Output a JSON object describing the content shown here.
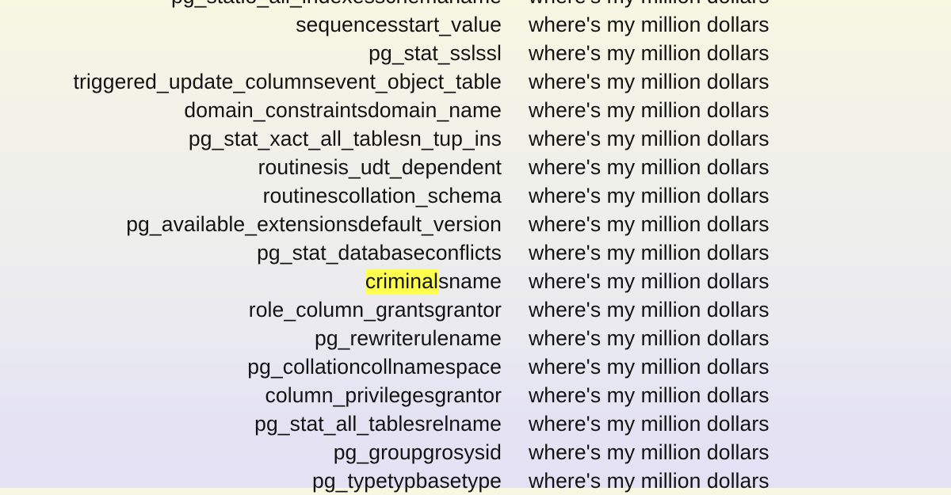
{
  "colors": {
    "background_top": "#f7f7e2",
    "background_mid": "#eeeeec",
    "background_bottom": "#e3e1f3",
    "text": "#131313",
    "highlight": "#ffff4f"
  },
  "list": {
    "note_text": "where's my million dollars",
    "highlight_term": "criminal",
    "rows": [
      {
        "name": "pg_statio_all_indexesschemaname",
        "note": "where's my million dollars",
        "clipped": true
      },
      {
        "name": "sequencesstart_value",
        "note": "where's my million dollars"
      },
      {
        "name": "pg_stat_sslssl",
        "note": "where's my million dollars"
      },
      {
        "name": "triggered_update_columnsevent_object_table",
        "note": "where's my million dollars",
        "overflow": true
      },
      {
        "name": "domain_constraintsdomain_name",
        "note": "where's my million dollars"
      },
      {
        "name": "pg_stat_xact_all_tablesn_tup_ins",
        "note": "where's my million dollars"
      },
      {
        "name": "routinesis_udt_dependent",
        "note": "where's my million dollars"
      },
      {
        "name": "routinescollation_schema",
        "note": "where's my million dollars"
      },
      {
        "name": "pg_available_extensionsdefault_version",
        "note": "where's my million dollars",
        "overflow": true
      },
      {
        "name": "pg_stat_databaseconflicts",
        "note": "where's my million dollars"
      },
      {
        "name": "criminalsname",
        "note": "where's my million dollars",
        "highlight_prefix": "criminal",
        "rest": "sname"
      },
      {
        "name": "role_column_grantsgrantor",
        "note": "where's my million dollars"
      },
      {
        "name": "pg_rewriterulename",
        "note": "where's my million dollars"
      },
      {
        "name": "pg_collationcollnamespace",
        "note": "where's my million dollars"
      },
      {
        "name": "column_privilegesgrantor",
        "note": "where's my million dollars"
      },
      {
        "name": "pg_stat_all_tablesrelname",
        "note": "where's my million dollars"
      },
      {
        "name": "pg_groupgrosysid",
        "note": "where's my million dollars"
      },
      {
        "name": "pg_typetypbasetype",
        "note": "where's my million dollars"
      }
    ]
  }
}
